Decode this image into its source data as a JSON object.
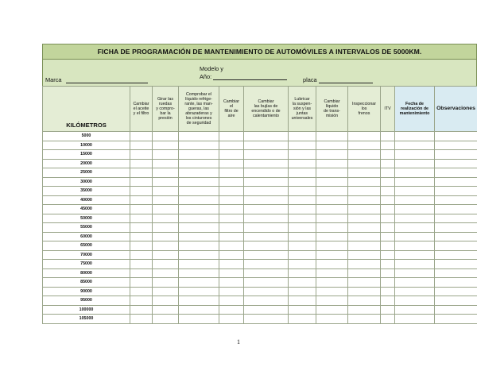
{
  "document": {
    "title": "FICHA DE PROGRAMACIÓN DE MANTENIMIENTO DE AUTOMÓVILES A INTERVALOS DE 5000KM.",
    "fields": {
      "marca_label": "Marca",
      "modelo_label_1": "Modelo y",
      "modelo_label_2": "Año:",
      "placa_label": "placa"
    },
    "columns": [
      "KILÓMETROS",
      "Cambiar el aceite y el filtro",
      "Girar las ruedas y comprobar la presión",
      "Comprobar el líquido refrigerante, las mangueras, las abrazaderas y los cinturones de seguridad",
      "Cambiar el filtro de aire",
      "Cambiar las bujías de encendido o de calentamiento",
      "Lubricar la suspensión y las juntas universales",
      "Cambiar líquido de transmisión",
      "Inspeccionar los frenos",
      "ITV",
      "Fecha de realización de mantenimiento",
      "Observaciones"
    ],
    "column_labels_as_printed": [
      "KILÓMETROS",
      "Cambiar\nel aceite\ny el filtro",
      "Girar las\nruedas\ny compro-\nbar la\npresión",
      "Comprobar el\nlíquido refrige-\nrante, las man-\ngueras, las\nabrazaderas y\nlos cinturones\nde seguridad",
      "Cambiar\nel\nfiltro de\naire",
      "Cambiar\nlas bujías de\nencendido o de\ncalentamiento",
      "Lubricar\nla suspen-\nsión y las\njuntas\nuniversales",
      "Cambiar\nlíquido\nde trans-\nmisión",
      "Inspeccionar\nlos\nfrenos",
      "ITV",
      "Fecha de\nrealización de\nmantenimiento",
      "Observaciones"
    ],
    "km_rows": [
      "5000",
      "10000",
      "15000",
      "20000",
      "25000",
      "30000",
      "35000",
      "40000",
      "45000",
      "50000",
      "55000",
      "60000",
      "65000",
      "70000",
      "75000",
      "80000",
      "85000",
      "90000",
      "95000",
      "100000",
      "105000"
    ],
    "page_number": "1"
  },
  "colors": {
    "title_bg": "#c2d59c",
    "info_bg": "#d8e6c0",
    "header_bg": "#e4edd5",
    "highlight_header_bg": "#d9ebf2",
    "grid_line": "#9aa58a"
  }
}
